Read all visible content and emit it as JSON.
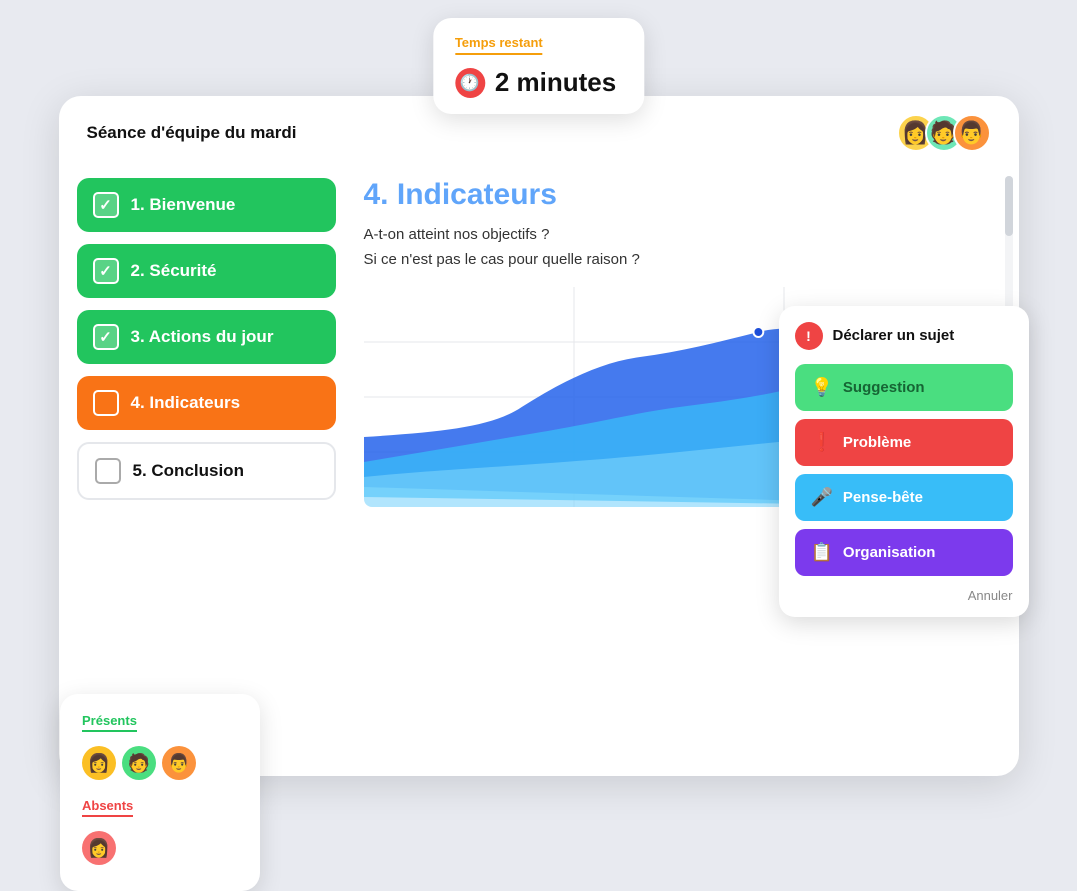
{
  "timer": {
    "label": "Temps restant",
    "value": "2 minutes",
    "icon": "🕐"
  },
  "session": {
    "title": "Séance d'équipe du mardi"
  },
  "agenda": [
    {
      "id": 1,
      "label": "1. Bienvenue",
      "status": "completed"
    },
    {
      "id": 2,
      "label": "2. Sécurité",
      "status": "completed"
    },
    {
      "id": 3,
      "label": "3. Actions du jour",
      "status": "completed"
    },
    {
      "id": 4,
      "label": "4. Indicateurs",
      "status": "active"
    },
    {
      "id": 5,
      "label": "5. Conclusion",
      "status": "pending"
    }
  ],
  "section": {
    "title": "4. Indicateurs",
    "question1": "A-t-on atteint nos objectifs ?",
    "question2": "Si ce n'est pas le cas pour quelle raison ?"
  },
  "attendees": {
    "presents_label": "Présents",
    "absents_label": "Absents",
    "present_count": 3,
    "absent_count": 1
  },
  "subject_popup": {
    "declare_label": "Déclarer un sujet",
    "suggestion_label": "Suggestion",
    "probleme_label": "Problème",
    "pensebete_label": "Pense-bête",
    "organisation_label": "Organisation",
    "cancel_label": "Annuler"
  }
}
